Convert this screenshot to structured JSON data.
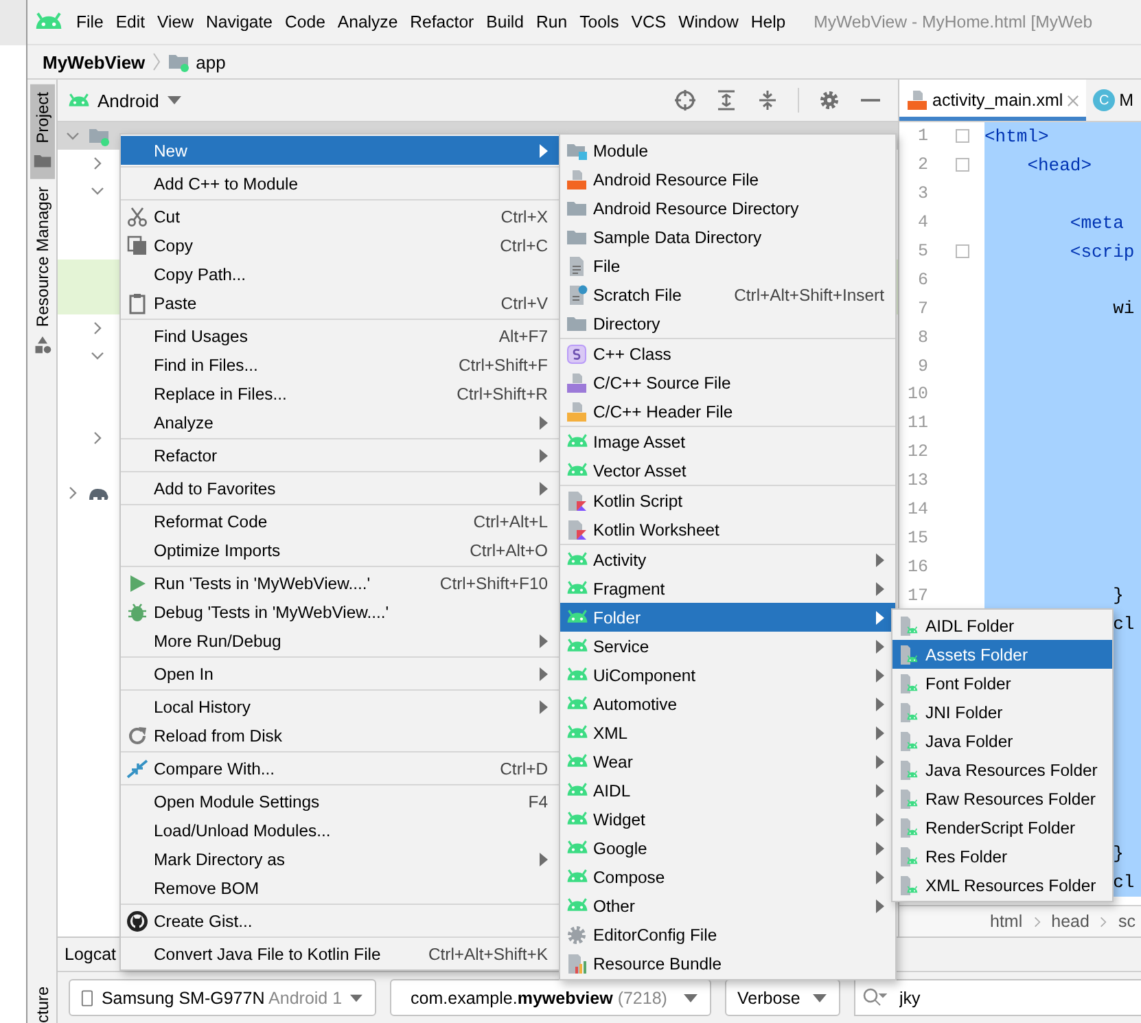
{
  "menu_bar": {
    "items": [
      "File",
      "Edit",
      "View",
      "Navigate",
      "Code",
      "Analyze",
      "Refactor",
      "Build",
      "Run",
      "Tools",
      "VCS",
      "Window",
      "Help"
    ],
    "window_title": "MyWebView - MyHome.html [MyWeb"
  },
  "breadcrumb": {
    "project": "MyWebView",
    "module": "app"
  },
  "tool_stripe": {
    "tabs": [
      {
        "label": "Project",
        "selected": true
      },
      {
        "label": "Resource Manager",
        "selected": false
      }
    ],
    "bottom_tab": "cture"
  },
  "project_panel": {
    "view": "Android",
    "tree": [
      {
        "kind": "module",
        "expanded": true,
        "selected": true,
        "children": [
          {
            "kind": "folder",
            "expanded": false
          },
          {
            "kind": "folder",
            "expanded": true,
            "children": [
              {
                "kind": "file",
                "highlighted": false
              },
              {
                "kind": "file",
                "highlighted": false
              },
              {
                "kind": "file",
                "highlighted": true
              },
              {
                "kind": "file",
                "highlighted": true
              }
            ]
          },
          {
            "kind": "folder",
            "expanded": false
          },
          {
            "kind": "folder",
            "expanded": true,
            "children": [
              {
                "kind": "file",
                "highlighted": false
              },
              {
                "kind": "file",
                "highlighted": false
              }
            ]
          },
          {
            "kind": "folder",
            "expanded": false
          },
          {
            "kind": "file",
            "highlighted": false
          }
        ]
      },
      {
        "kind": "gradle",
        "expanded": false
      }
    ]
  },
  "editor": {
    "tabs": [
      {
        "label": "activity_main.xml",
        "kind": "xml",
        "selected": true
      },
      {
        "label": "M",
        "kind": "class",
        "icon_text": "C",
        "selected": false
      }
    ],
    "lines": [
      {
        "number": "1",
        "text": "<html>",
        "kind": "tag",
        "fold": true,
        "selected": true
      },
      {
        "number": "2",
        "text": "    <head>",
        "kind": "tag",
        "fold": true,
        "selected": true
      },
      {
        "number": "3",
        "fold": false,
        "selected": true
      },
      {
        "number": "4",
        "text": "        <meta",
        "kind": "tag",
        "fold": false,
        "selected": true
      },
      {
        "number": "5",
        "text": "        <scrip",
        "kind": "tag",
        "fold": true,
        "selected": true
      },
      {
        "number": "6",
        "fold": false,
        "selected": true
      },
      {
        "number": "7",
        "text": "            wi",
        "kind": "code",
        "fold": false,
        "selected": true
      },
      {
        "number": "8",
        "fold": false,
        "selected": true
      },
      {
        "number": "9",
        "fold": false,
        "selected": true
      },
      {
        "number": "10",
        "fold": false,
        "selected": true
      },
      {
        "number": "11",
        "fold": false,
        "selected": true
      },
      {
        "number": "12",
        "fold": false,
        "selected": true
      },
      {
        "number": "13",
        "fold": false,
        "selected": true
      },
      {
        "number": "14",
        "fold": false,
        "selected": true
      },
      {
        "number": "15",
        "fold": false,
        "selected": true
      },
      {
        "number": "16",
        "fold": false,
        "selected": true
      },
      {
        "number": "17",
        "text": "            }",
        "kind": "code",
        "fold": false,
        "selected": true
      },
      {
        "text": "            cl",
        "kind": "code",
        "fold": false,
        "selected": true
      },
      {
        "fold": false,
        "selected": true
      },
      {
        "fold": false,
        "selected": true
      },
      {
        "fold": false,
        "selected": true
      },
      {
        "fold": false,
        "selected": true
      },
      {
        "fold": false,
        "selected": true
      },
      {
        "fold": false,
        "selected": true
      },
      {
        "fold": false,
        "selected": true
      },
      {
        "text": "            }",
        "kind": "code",
        "fold": false,
        "selected": true
      },
      {
        "text": "            cl",
        "kind": "code",
        "fold": false,
        "selected": true
      }
    ],
    "breadcrumb": [
      "html",
      "head",
      "sc"
    ]
  },
  "logcat": {
    "title": "Logcat",
    "device": "Samsung SM-G977N",
    "device_detail": "Android 1",
    "process": "com.example.**mywebview**",
    "pid": "(7218)",
    "level": "Verbose",
    "search": "jky"
  },
  "context_menu": {
    "groups": [
      {
        "items": [
          {
            "label": "New",
            "submenu": true,
            "selected": true
          }
        ]
      },
      {
        "items": [
          {
            "label": "Add C++ to Module",
            "submenu": false,
            "selected": false
          }
        ]
      },
      {
        "items": [
          {
            "label": "Cut",
            "shortcut": "Ctrl+X",
            "kind": "cut",
            "submenu": false,
            "selected": false
          },
          {
            "label": "Copy",
            "shortcut": "Ctrl+C",
            "kind": "copy",
            "submenu": false,
            "selected": false
          },
          {
            "label": "Copy Path...",
            "submenu": false,
            "selected": false
          },
          {
            "label": "Paste",
            "shortcut": "Ctrl+V",
            "kind": "paste",
            "submenu": false,
            "selected": false
          }
        ]
      },
      {
        "items": [
          {
            "label": "Find Usages",
            "shortcut": "Alt+F7",
            "submenu": false,
            "selected": false
          },
          {
            "label": "Find in Files...",
            "shortcut": "Ctrl+Shift+F",
            "submenu": false,
            "selected": false
          },
          {
            "label": "Replace in Files...",
            "shortcut": "Ctrl+Shift+R",
            "submenu": false,
            "selected": false
          },
          {
            "label": "Analyze",
            "submenu": true,
            "selected": false
          }
        ]
      },
      {
        "items": [
          {
            "label": "Refactor",
            "submenu": true,
            "selected": false
          }
        ]
      },
      {
        "items": [
          {
            "label": "Add to Favorites",
            "submenu": true,
            "selected": false
          }
        ]
      },
      {
        "items": [
          {
            "label": "Reformat Code",
            "shortcut": "Ctrl+Alt+L",
            "submenu": false,
            "selected": false
          },
          {
            "label": "Optimize Imports",
            "shortcut": "Ctrl+Alt+O",
            "submenu": false,
            "selected": false
          }
        ]
      },
      {
        "items": [
          {
            "label": "Run 'Tests in 'MyWebView....'",
            "shortcut": "Ctrl+Shift+F10",
            "kind": "run",
            "submenu": false,
            "selected": false
          },
          {
            "label": "Debug 'Tests in 'MyWebView....'",
            "kind": "debug",
            "submenu": false,
            "selected": false
          },
          {
            "label": "More Run/Debug",
            "submenu": true,
            "selected": false
          }
        ]
      },
      {
        "items": [
          {
            "label": "Open In",
            "submenu": true,
            "selected": false
          }
        ]
      },
      {
        "items": [
          {
            "label": "Local History",
            "submenu": true,
            "selected": false
          },
          {
            "label": "Reload from Disk",
            "kind": "reload",
            "submenu": false,
            "selected": false
          }
        ]
      },
      {
        "items": [
          {
            "label": "Compare With...",
            "shortcut": "Ctrl+D",
            "kind": "compare",
            "submenu": false,
            "selected": false
          }
        ]
      },
      {
        "items": [
          {
            "label": "Open Module Settings",
            "shortcut": "F4",
            "submenu": false,
            "selected": false
          },
          {
            "label": "Load/Unload Modules...",
            "submenu": false,
            "selected": false
          },
          {
            "label": "Mark Directory as",
            "submenu": true,
            "selected": false
          },
          {
            "label": "Remove BOM",
            "submenu": false,
            "selected": false
          }
        ]
      },
      {
        "items": [
          {
            "label": "Create Gist...",
            "kind": "github",
            "submenu": false,
            "selected": false
          }
        ]
      },
      {
        "items": [
          {
            "label": "Convert Java File to Kotlin File",
            "shortcut": "Ctrl+Alt+Shift+K",
            "submenu": false,
            "selected": false
          }
        ]
      }
    ]
  },
  "new_submenu": {
    "groups": [
      {
        "items": [
          {
            "label": "Module",
            "kind": "module",
            "submenu": false,
            "selected": false
          },
          {
            "label": "Android Resource File",
            "kind": "resource-file",
            "submenu": false,
            "selected": false
          },
          {
            "label": "Android Resource Directory",
            "kind": "folder",
            "submenu": false,
            "selected": false
          },
          {
            "label": "Sample Data Directory",
            "kind": "folder",
            "submenu": false,
            "selected": false
          },
          {
            "label": "File",
            "kind": "file",
            "submenu": false,
            "selected": false
          },
          {
            "label": "Scratch File",
            "shortcut": "Ctrl+Alt+Shift+Insert",
            "kind": "scratch",
            "submenu": false,
            "selected": false
          },
          {
            "label": "Directory",
            "kind": "folder",
            "submenu": false,
            "selected": false
          }
        ]
      },
      {
        "items": [
          {
            "label": "C++ Class",
            "kind": "class-s",
            "submenu": false,
            "selected": false
          },
          {
            "label": "C/C++ Source File",
            "kind": "cpp-source",
            "submenu": false,
            "selected": false
          },
          {
            "label": "C/C++ Header File",
            "kind": "cpp-header",
            "submenu": false,
            "selected": false
          }
        ]
      },
      {
        "items": [
          {
            "label": "Image Asset",
            "kind": "android",
            "submenu": false,
            "selected": false
          },
          {
            "label": "Vector Asset",
            "kind": "android",
            "submenu": false,
            "selected": false
          }
        ]
      },
      {
        "items": [
          {
            "label": "Kotlin Script",
            "kind": "kotlin",
            "submenu": false,
            "selected": false
          },
          {
            "label": "Kotlin Worksheet",
            "kind": "kotlin",
            "submenu": false,
            "selected": false
          }
        ]
      },
      {
        "items": [
          {
            "label": "Activity",
            "kind": "android",
            "submenu": true,
            "selected": false
          },
          {
            "label": "Fragment",
            "kind": "android",
            "submenu": true,
            "selected": false
          },
          {
            "label": "Folder",
            "kind": "android",
            "submenu": true,
            "selected": true
          },
          {
            "label": "Service",
            "kind": "android",
            "submenu": true,
            "selected": false
          },
          {
            "label": "UiComponent",
            "kind": "android",
            "submenu": true,
            "selected": false
          },
          {
            "label": "Automotive",
            "kind": "android",
            "submenu": true,
            "selected": false
          },
          {
            "label": "XML",
            "kind": "android",
            "submenu": true,
            "selected": false
          },
          {
            "label": "Wear",
            "kind": "android",
            "submenu": true,
            "selected": false
          },
          {
            "label": "AIDL",
            "kind": "android",
            "submenu": true,
            "selected": false
          },
          {
            "label": "Widget",
            "kind": "android",
            "submenu": true,
            "selected": false
          },
          {
            "label": "Google",
            "kind": "android",
            "submenu": true,
            "selected": false
          },
          {
            "label": "Compose",
            "kind": "android",
            "submenu": true,
            "selected": false
          },
          {
            "label": "Other",
            "kind": "android",
            "submenu": true,
            "selected": false
          },
          {
            "label": "EditorConfig File",
            "kind": "gear",
            "submenu": false,
            "selected": false
          },
          {
            "label": "Resource Bundle",
            "kind": "bundle",
            "submenu": false,
            "selected": false
          }
        ]
      }
    ]
  },
  "folder_submenu": {
    "groups": [
      {
        "items": [
          {
            "label": "AIDL Folder",
            "kind": "android-folder",
            "submenu": false,
            "selected": false
          },
          {
            "label": "Assets Folder",
            "kind": "android-folder",
            "submenu": false,
            "selected": true
          },
          {
            "label": "Font Folder",
            "kind": "android-folder",
            "submenu": false,
            "selected": false
          },
          {
            "label": "JNI Folder",
            "kind": "android-folder",
            "submenu": false,
            "selected": false
          },
          {
            "label": "Java Folder",
            "kind": "android-folder",
            "submenu": false,
            "selected": false
          },
          {
            "label": "Java Resources Folder",
            "kind": "android-folder",
            "submenu": false,
            "selected": false
          },
          {
            "label": "Raw Resources Folder",
            "kind": "android-folder",
            "submenu": false,
            "selected": false
          },
          {
            "label": "RenderScript Folder",
            "kind": "android-folder",
            "submenu": false,
            "selected": false
          },
          {
            "label": "Res Folder",
            "kind": "android-folder",
            "submenu": false,
            "selected": false
          },
          {
            "label": "XML Resources Folder",
            "kind": "android-folder",
            "submenu": false,
            "selected": false
          }
        ]
      }
    ]
  }
}
